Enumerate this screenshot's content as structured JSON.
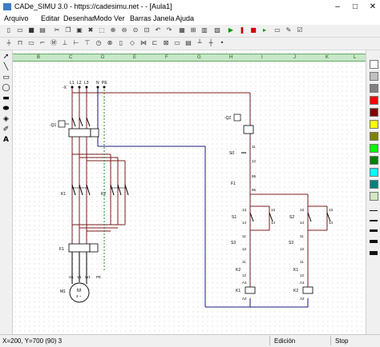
{
  "window": {
    "title": "CADe_SIMU 3.0 - https://cadesimu.net - - [Aula1]",
    "minimize": "–",
    "maximize": "□",
    "close": "✕"
  },
  "menu": [
    "Arquivo",
    "Editar",
    "Desenhar",
    "Modo",
    "Ver",
    "Barras",
    "Janela",
    "Ajuda"
  ],
  "ruler_labels": [
    "B",
    "C",
    "D",
    "E",
    "F",
    "G",
    "H",
    "I",
    "J",
    "K",
    "L"
  ],
  "schematic": {
    "power": {
      "phases": [
        "L1",
        "L2",
        "L3",
        "N",
        "PE"
      ],
      "input_mark": "-X",
      "q1": "-Q1",
      "k1": "K1",
      "k2": "K2",
      "f1": "F1",
      "motor": {
        "name": "M1",
        "terminals": [
          "U1",
          "V1",
          "W1",
          "PE"
        ],
        "label": "M",
        "sub": "3 ~"
      }
    },
    "control": {
      "q2": "-Q2",
      "s0": "S0",
      "f1": "F1",
      "s1": "S1",
      "s2": "S2",
      "s3": "S3",
      "k1": "K1",
      "k2": "K2",
      "t11": "11",
      "t12": "12",
      "t13": "13",
      "t14": "14",
      "t95": "95",
      "t96": "96",
      "a1": "A1",
      "a2": "A2"
    }
  },
  "status": {
    "coords": "X=200, Y=700 (90) 3",
    "mode": "Edición",
    "sim": "Stop"
  },
  "colors": [
    "#ffffff",
    "#c0c0c0",
    "#808080",
    "#ff0000",
    "#800000",
    "#ffff00",
    "#808000",
    "#00ff00",
    "#008000",
    "#00ffff",
    "#008080",
    "#d4e8c0"
  ]
}
